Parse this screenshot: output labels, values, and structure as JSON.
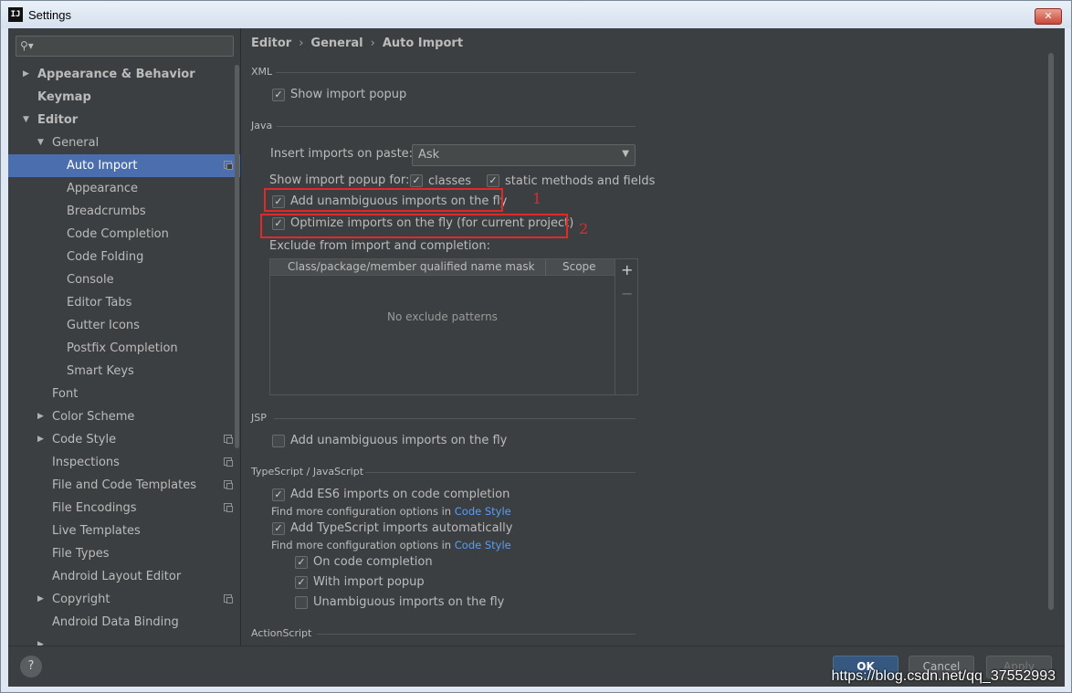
{
  "window": {
    "title": "Settings",
    "app_icon": "IJ",
    "close_label": "✕"
  },
  "sidebar": {
    "search_placeholder": "",
    "items": [
      {
        "label": "Appearance & Behavior",
        "level": 0,
        "arrow": "▶",
        "bold": true
      },
      {
        "label": "Keymap",
        "level": 0,
        "arrow": "",
        "bold": true
      },
      {
        "label": "Editor",
        "level": 0,
        "arrow": "▼",
        "bold": true
      },
      {
        "label": "General",
        "level": 1,
        "arrow": "▼"
      },
      {
        "label": "Auto Import",
        "level": 2,
        "arrow": "",
        "selected": true,
        "copy": true
      },
      {
        "label": "Appearance",
        "level": 2,
        "arrow": ""
      },
      {
        "label": "Breadcrumbs",
        "level": 2,
        "arrow": ""
      },
      {
        "label": "Code Completion",
        "level": 2,
        "arrow": ""
      },
      {
        "label": "Code Folding",
        "level": 2,
        "arrow": ""
      },
      {
        "label": "Console",
        "level": 2,
        "arrow": ""
      },
      {
        "label": "Editor Tabs",
        "level": 2,
        "arrow": ""
      },
      {
        "label": "Gutter Icons",
        "level": 2,
        "arrow": ""
      },
      {
        "label": "Postfix Completion",
        "level": 2,
        "arrow": ""
      },
      {
        "label": "Smart Keys",
        "level": 2,
        "arrow": ""
      },
      {
        "label": "Font",
        "level": 1,
        "arrow": ""
      },
      {
        "label": "Color Scheme",
        "level": 1,
        "arrow": "▶"
      },
      {
        "label": "Code Style",
        "level": 1,
        "arrow": "▶",
        "copy": true
      },
      {
        "label": "Inspections",
        "level": 1,
        "arrow": "",
        "copy": true
      },
      {
        "label": "File and Code Templates",
        "level": 1,
        "arrow": "",
        "copy": true
      },
      {
        "label": "File Encodings",
        "level": 1,
        "arrow": "",
        "copy": true
      },
      {
        "label": "Live Templates",
        "level": 1,
        "arrow": ""
      },
      {
        "label": "File Types",
        "level": 1,
        "arrow": ""
      },
      {
        "label": "Android Layout Editor",
        "level": 1,
        "arrow": ""
      },
      {
        "label": "Copyright",
        "level": 1,
        "arrow": "▶",
        "copy": true
      },
      {
        "label": "Android Data Binding",
        "level": 1,
        "arrow": ""
      },
      {
        "label": "",
        "level": 1,
        "arrow": "▶"
      }
    ]
  },
  "breadcrumb": [
    "Editor",
    "General",
    "Auto Import"
  ],
  "breadcrumb_sep": "›",
  "xml": {
    "title": "XML",
    "show_import_popup": {
      "label": "Show import popup",
      "checked": true
    }
  },
  "java": {
    "title": "Java",
    "insert_label": "Insert imports on paste:",
    "insert_value": "Ask",
    "popup_for_label": "Show import popup for:",
    "classes": {
      "label": "classes",
      "checked": true
    },
    "static_methods": {
      "label": "static methods and fields",
      "checked": true
    },
    "add_unambiguous": {
      "label": "Add unambiguous imports on the fly",
      "checked": true
    },
    "optimize": {
      "label": "Optimize imports on the fly (for current project)",
      "checked": true
    },
    "exclude_label": "Exclude from import and completion:",
    "table": {
      "col1": "Class/package/member qualified name mask",
      "col2": "Scope",
      "empty": "No exclude patterns",
      "add": "+",
      "remove": "−"
    }
  },
  "annotations": {
    "one": "1",
    "two": "2"
  },
  "jsp": {
    "title": "JSP",
    "add_unambiguous": {
      "label": "Add unambiguous imports on the fly",
      "checked": false
    }
  },
  "ts": {
    "title": "TypeScript / JavaScript",
    "es6": {
      "label": "Add ES6 imports on code completion",
      "checked": true
    },
    "find_more_1": "Find more configuration options in ",
    "code_style_link_1": "Code Style",
    "ts_auto": {
      "label": "Add TypeScript imports automatically",
      "checked": true
    },
    "find_more_2": "Find more configuration options in ",
    "code_style_link_2": "Code Style",
    "on_completion": {
      "label": "On code completion",
      "checked": true
    },
    "with_popup": {
      "label": "With import popup",
      "checked": true
    },
    "unambiguous": {
      "label": "Unambiguous imports on the fly",
      "checked": false
    }
  },
  "actionscript": {
    "title": "ActionScript"
  },
  "footer": {
    "help": "?",
    "ok": "OK",
    "cancel": "Cancel",
    "apply": "Apply",
    "watermark": "https://blog.csdn.net/qq_37552993"
  },
  "check_glyph": "✓",
  "colors": {
    "selection": "#4b6eaf",
    "highlight": "#e02a2a",
    "link": "#589df6",
    "primary": "#365880"
  }
}
